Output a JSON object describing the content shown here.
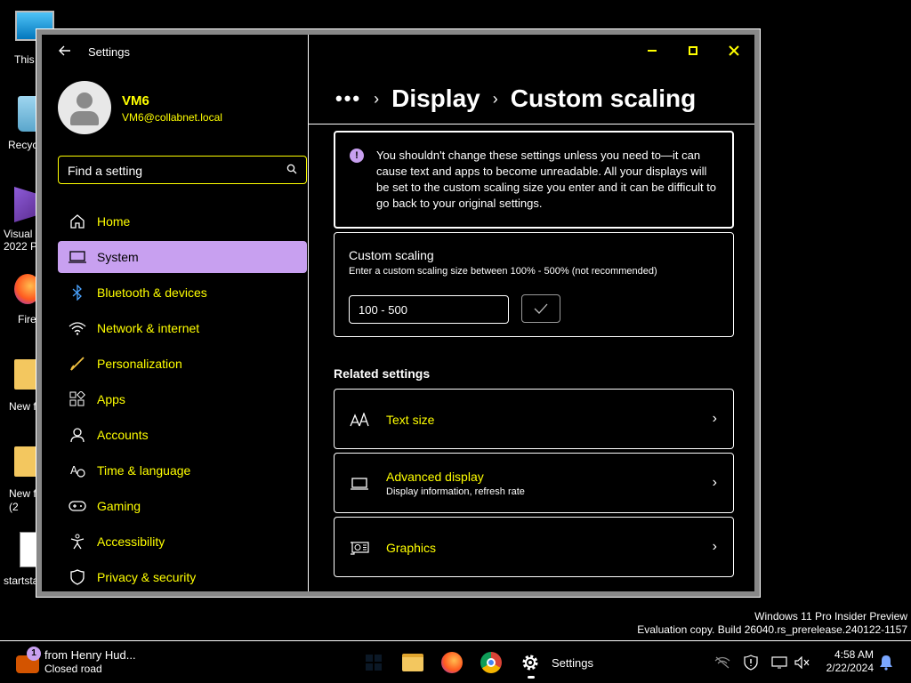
{
  "desktop": {
    "icons": [
      {
        "label": "This"
      },
      {
        "label": "Recyc"
      },
      {
        "label": "Visual\n2022 P"
      },
      {
        "label": "Fire"
      },
      {
        "label": "New f"
      },
      {
        "label": "New f\n(2"
      },
      {
        "label": "startsta"
      }
    ]
  },
  "window": {
    "app_title": "Settings",
    "profile": {
      "name": "VM6",
      "email": "VM6@collabnet.local"
    },
    "search": {
      "placeholder": "Find a setting"
    },
    "nav": [
      {
        "label": "Home",
        "icon": "home-icon"
      },
      {
        "label": "System",
        "icon": "laptop-icon",
        "selected": true
      },
      {
        "label": "Bluetooth & devices",
        "icon": "bluetooth-icon"
      },
      {
        "label": "Network & internet",
        "icon": "wifi-icon"
      },
      {
        "label": "Personalization",
        "icon": "brush-icon"
      },
      {
        "label": "Apps",
        "icon": "apps-icon"
      },
      {
        "label": "Accounts",
        "icon": "person-icon"
      },
      {
        "label": "Time & language",
        "icon": "globe-clock-icon"
      },
      {
        "label": "Gaming",
        "icon": "gamepad-icon"
      },
      {
        "label": "Accessibility",
        "icon": "accessibility-icon"
      },
      {
        "label": "Privacy & security",
        "icon": "shield-icon"
      }
    ],
    "breadcrumb": {
      "more": "•••",
      "items": [
        "Display",
        "Custom scaling"
      ]
    },
    "warning": {
      "text": "You shouldn't change these settings unless you need to—it can cause text and apps to become unreadable. All your displays will be set to the custom scaling size you enter and it can be difficult to go back to your original settings."
    },
    "custom_scaling": {
      "title": "Custom scaling",
      "description": "Enter a custom scaling size between 100% - 500% (not recommended)",
      "input_value": "100 - 500"
    },
    "related": {
      "heading": "Related settings",
      "items": [
        {
          "title": "Text size",
          "subtitle": "",
          "icon": "text-size-icon"
        },
        {
          "title": "Advanced display",
          "subtitle": "Display information, refresh rate",
          "icon": "monitor-icon"
        },
        {
          "title": "Graphics",
          "subtitle": "",
          "icon": "graphics-card-icon"
        }
      ]
    }
  },
  "watermark": {
    "line1": "Windows 11 Pro Insider Preview",
    "line2": "Evaluation copy. Build 26040.rs_prerelease.240122-1157"
  },
  "taskbar": {
    "widget": {
      "badge": "1",
      "line1": "from Henry Hud...",
      "line2": "Closed road"
    },
    "settings_label": "Settings",
    "clock": {
      "time": "4:58 AM",
      "date": "2/22/2024"
    }
  },
  "colors": {
    "accent": "#c8a0f0",
    "link": "#ffff00",
    "background": "#000000",
    "foreground": "#ffffff"
  }
}
